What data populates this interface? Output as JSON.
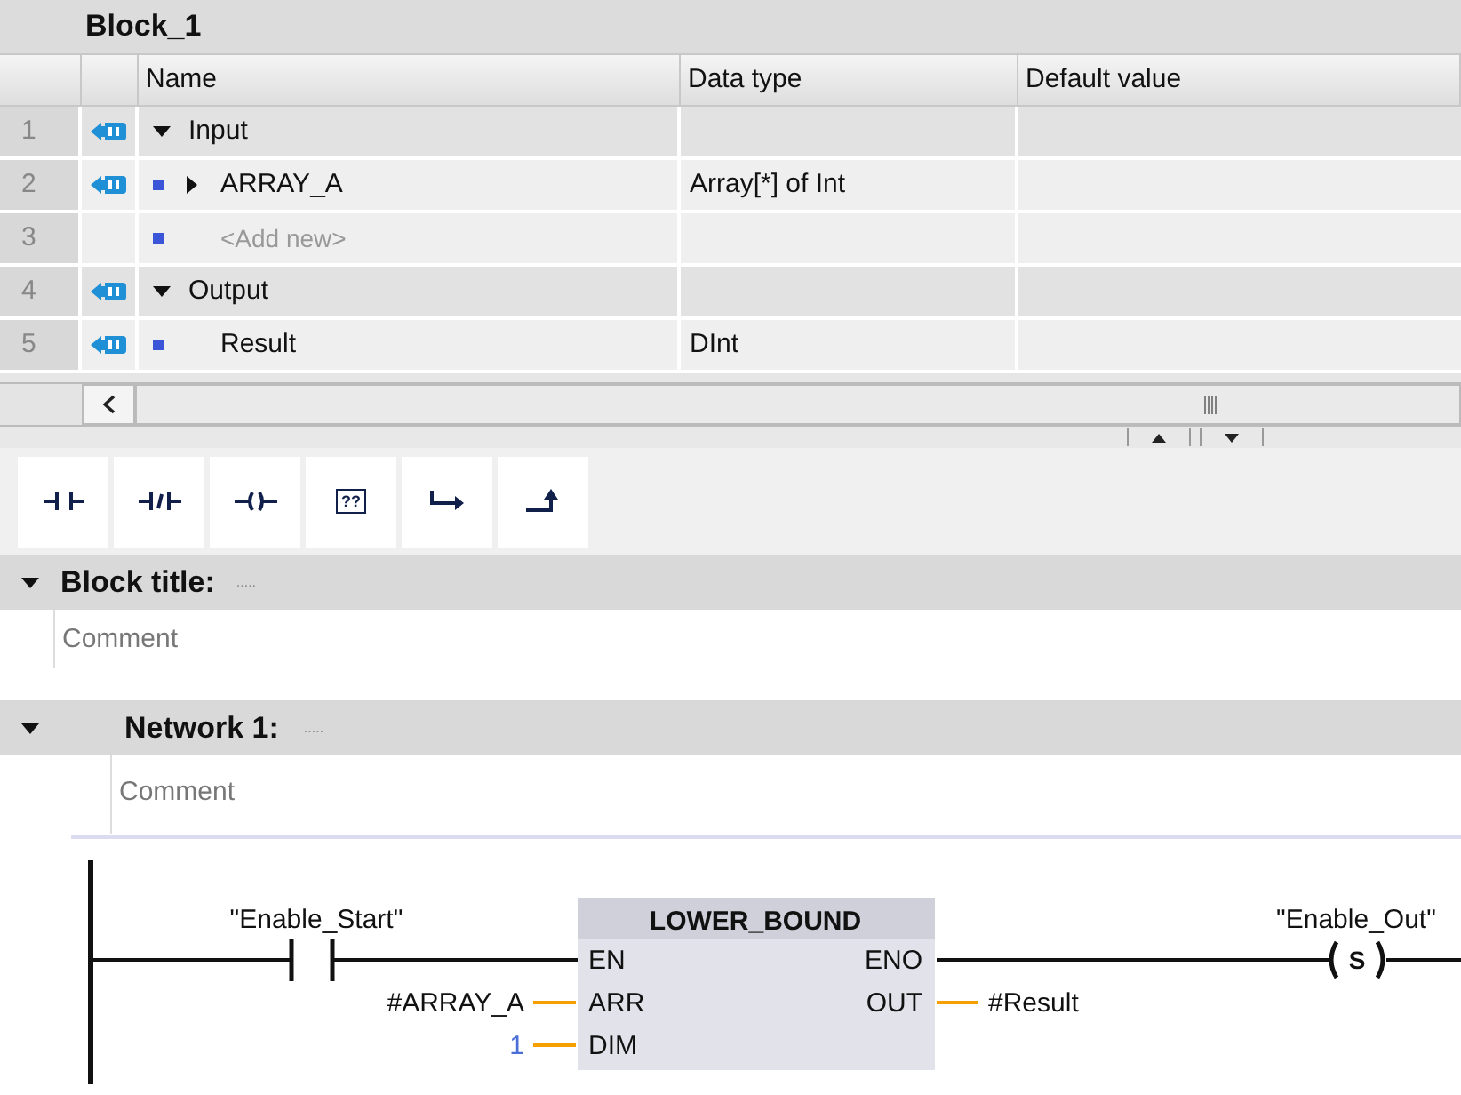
{
  "block_name": "Block_1",
  "interface_table": {
    "columns": [
      "Name",
      "Data type",
      "Default value"
    ],
    "rows": [
      {
        "number": "1",
        "kind": "section",
        "expanded": true,
        "name": "Input"
      },
      {
        "number": "2",
        "kind": "variable",
        "expanded": false,
        "name": "ARRAY_A",
        "data_type": "Array[*] of Int"
      },
      {
        "number": "3",
        "kind": "add_new",
        "name": "<Add new>"
      },
      {
        "number": "4",
        "kind": "section",
        "expanded": true,
        "name": "Output"
      },
      {
        "number": "5",
        "kind": "variable",
        "name": "Result",
        "data_type": "DInt"
      }
    ]
  },
  "toolbar": [
    {
      "kind": "no_contact"
    },
    {
      "kind": "nc_contact"
    },
    {
      "kind": "coil"
    },
    {
      "kind": "empty_box",
      "label": "??"
    },
    {
      "kind": "open_branch"
    },
    {
      "kind": "close_branch"
    }
  ],
  "block_title": {
    "label": "Block title:",
    "title_placeholder": ".....",
    "expanded": true,
    "comment": "Comment"
  },
  "network": {
    "label": "Network 1:",
    "title_placeholder": ".....",
    "expanded": true,
    "comment": "Comment",
    "ladder": {
      "contact_operand": "\"Enable_Start\"",
      "box_title": "LOWER_BOUND",
      "inputs": [
        {
          "pin": "EN"
        },
        {
          "pin": "ARR",
          "operand": "#ARRAY_A",
          "kind": "variable"
        },
        {
          "pin": "DIM",
          "operand": "1",
          "kind": "constant"
        }
      ],
      "outputs": [
        {
          "pin": "ENO"
        },
        {
          "pin": "OUT",
          "operand": "#Result"
        }
      ],
      "coil_operand": "\"Enable_Out\"",
      "coil_type": "S"
    }
  }
}
